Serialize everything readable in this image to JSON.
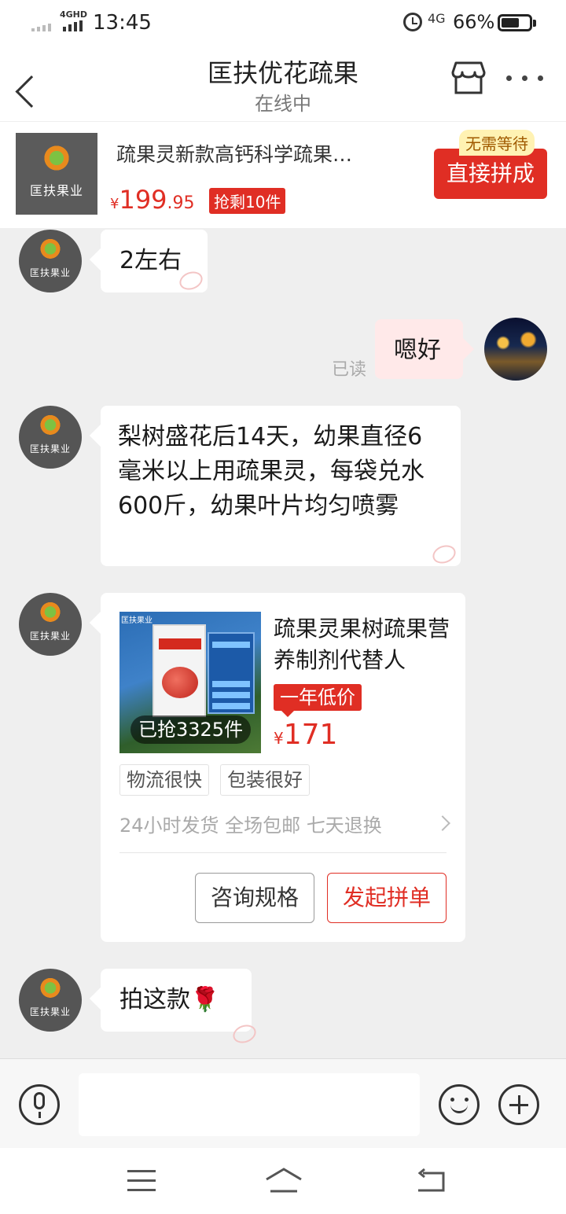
{
  "status_bar": {
    "network": "4GHD",
    "time": "13:45",
    "network2": "4G",
    "battery_percent": "66%",
    "battery_level": 0.66
  },
  "header": {
    "title": "匡扶优花疏果",
    "subtitle": "在线中"
  },
  "banner": {
    "product_name": "疏果灵新款高钙科学疏果…",
    "brand_text": "匡扶果业",
    "currency": "¥",
    "price_int": "199",
    "price_dec": ".95",
    "stock_tag": "抢剩10件",
    "no_wait_tag": "无需等待",
    "buy_button": "直接拼成"
  },
  "chat": {
    "avatar_brand": "匡扶果业",
    "msg1": "2左右",
    "msg2": "嗯好",
    "read_label": "已读",
    "msg3": "梨树盛花后14天，幼果直径6毫米以上用疏果灵，每袋兑水600斤，幼果叶片均匀喷雾",
    "msg5": "拍这款🌹"
  },
  "product_card": {
    "image_caption": "匡扶果业",
    "sold_badge": "已抢3325件",
    "title": "疏果灵果树疏果营养制剂代替人",
    "low_price_tag": "一年低价",
    "currency": "¥",
    "price": "171",
    "tags": [
      "物流很快",
      "包装很好"
    ],
    "services": "24小时发货 全场包邮 七天退换",
    "ask_button": "咨询规格",
    "group_button": "发起拼单"
  },
  "input_bar": {
    "placeholder": ""
  }
}
